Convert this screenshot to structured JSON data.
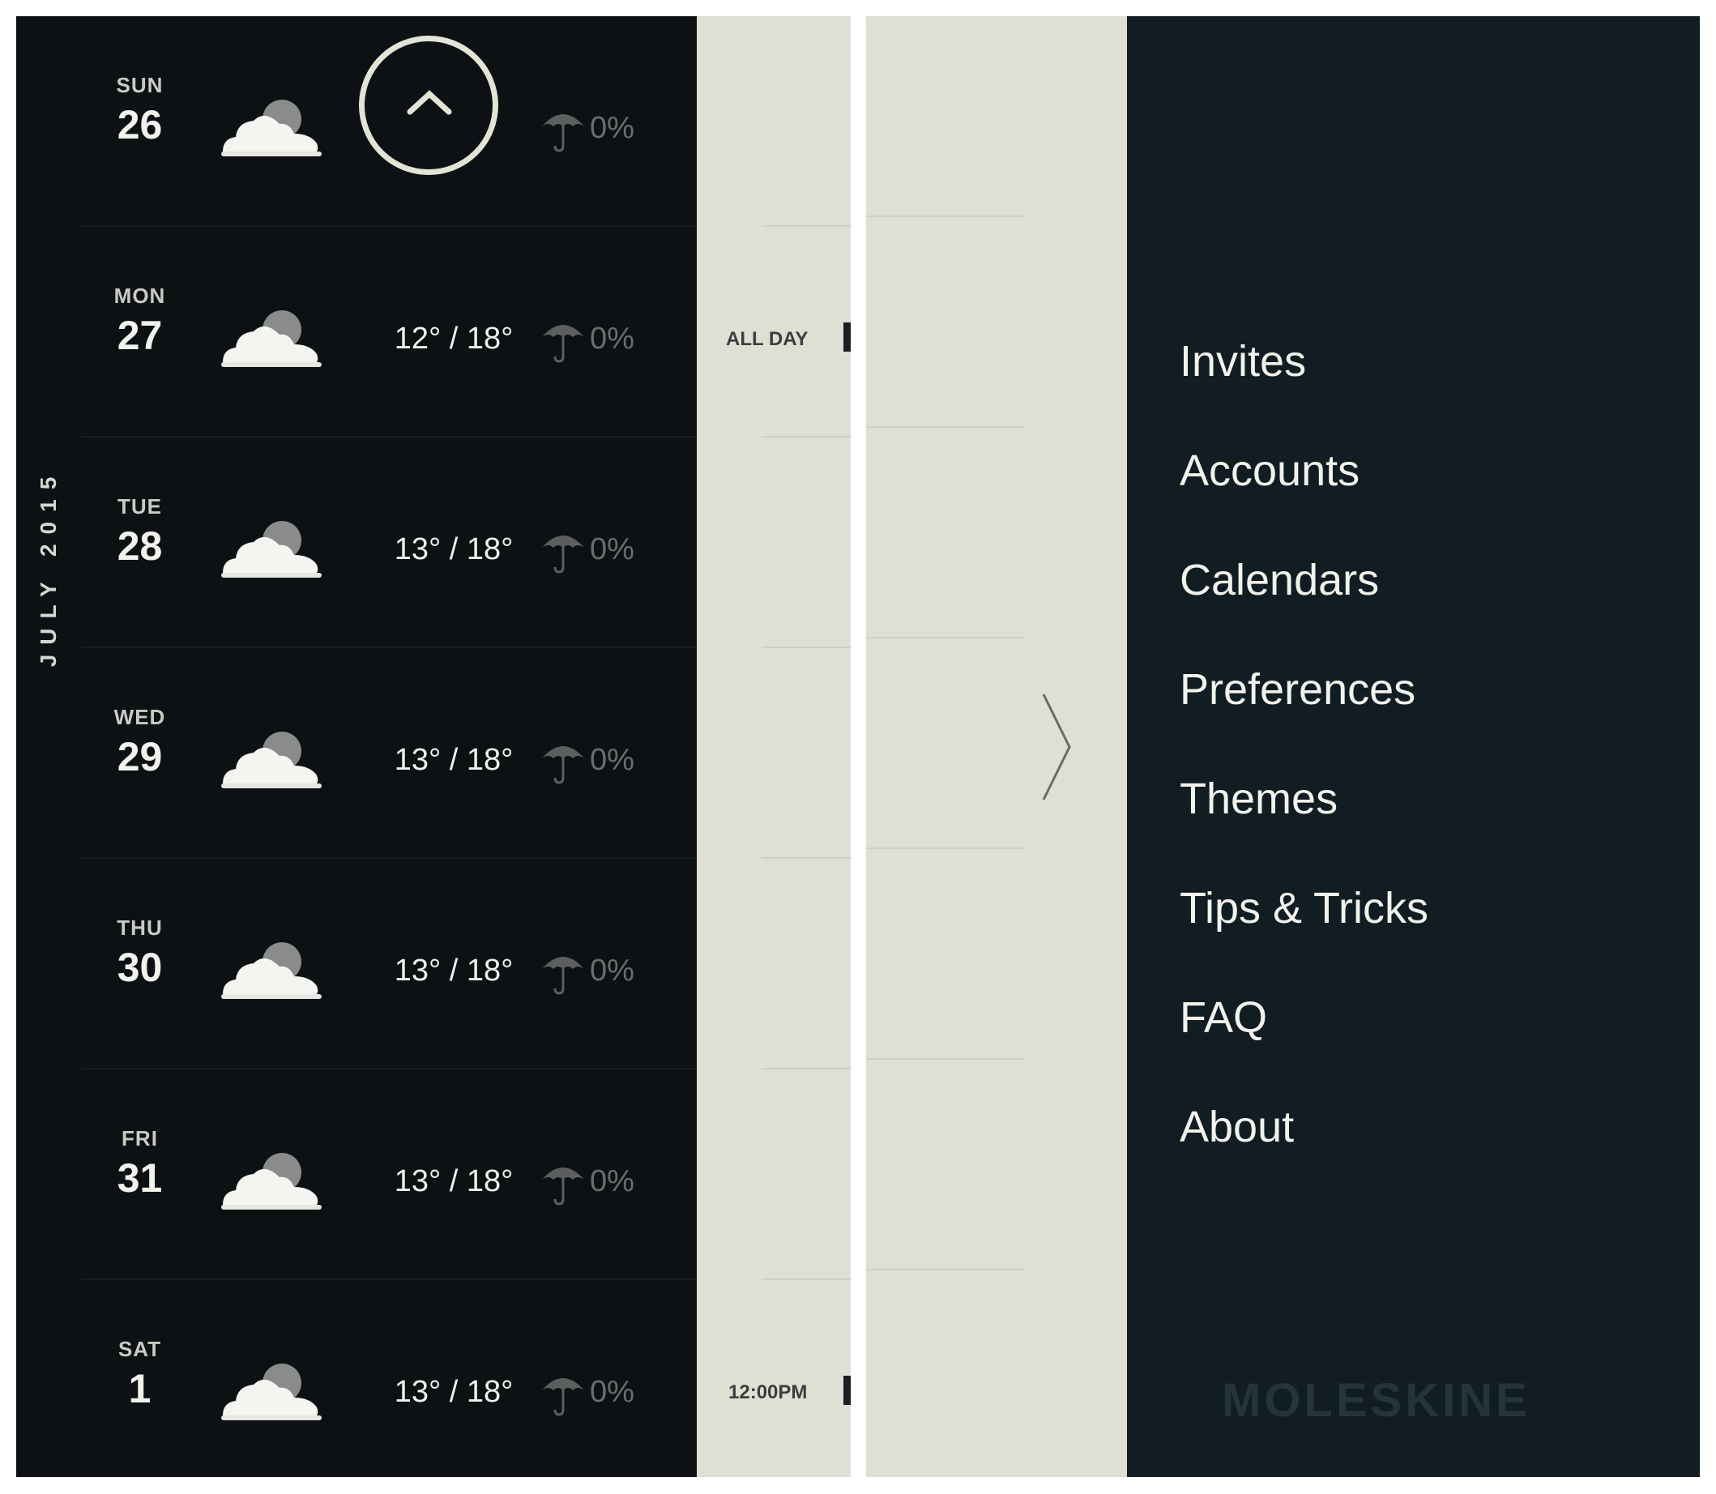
{
  "month_label": "JULY 2015",
  "days": [
    {
      "dow": "SUN",
      "day": "26",
      "temp": "",
      "precip": "0%",
      "icon": "partly-cloudy-icon"
    },
    {
      "dow": "MON",
      "day": "27",
      "temp": "12° / 18°",
      "precip": "0%",
      "icon": "partly-cloudy-icon"
    },
    {
      "dow": "TUE",
      "day": "28",
      "temp": "13° / 18°",
      "precip": "0%",
      "icon": "partly-cloudy-icon"
    },
    {
      "dow": "WED",
      "day": "29",
      "temp": "13° / 18°",
      "precip": "0%",
      "icon": "partly-cloudy-icon"
    },
    {
      "dow": "THU",
      "day": "30",
      "temp": "13° / 18°",
      "precip": "0%",
      "icon": "partly-cloudy-icon"
    },
    {
      "dow": "FRI",
      "day": "31",
      "temp": "13° / 18°",
      "precip": "0%",
      "icon": "partly-cloudy-icon"
    },
    {
      "dow": "SAT",
      "day": "1",
      "temp": "13° / 18°",
      "precip": "0%",
      "icon": "partly-cloudy-icon"
    }
  ],
  "events": {
    "mon_time": "ALL DAY",
    "sat_time": "12:00PM"
  },
  "menu": {
    "items": [
      "Invites",
      "Accounts",
      "Calendars",
      "Preferences",
      "Themes",
      "Tips & Tricks",
      "FAQ",
      "About"
    ],
    "brand": "MOLESKINE"
  },
  "icons": {
    "scroll_up": "chevron-up-icon",
    "collapse": "chevron-right-icon",
    "precip": "umbrella-icon"
  },
  "colors": {
    "weather_bg": "#0d1114",
    "calendar_bg": "#dfe0d3",
    "menu_bg": "#111d22",
    "accent_ring": "#e3e4d6"
  }
}
